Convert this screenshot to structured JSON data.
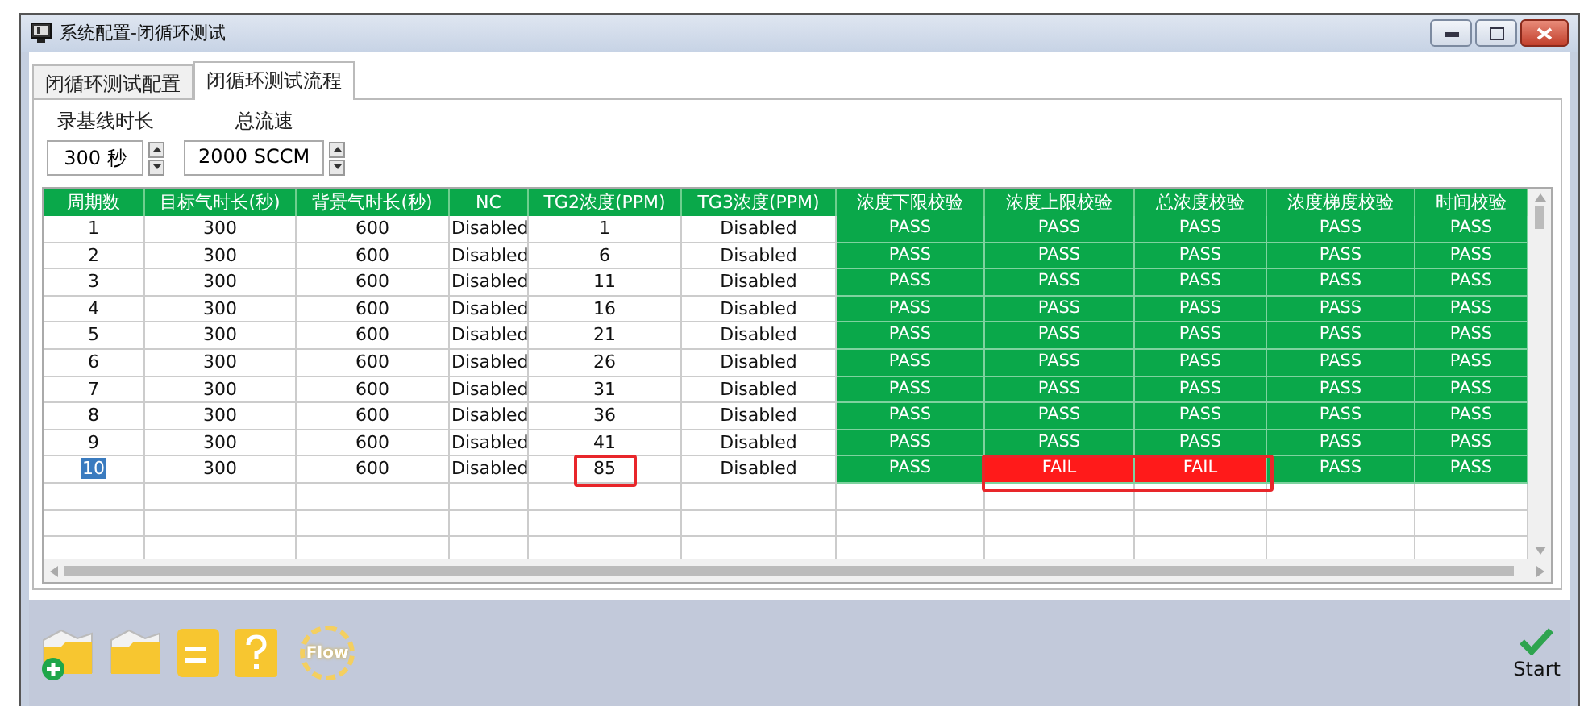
{
  "window": {
    "title": "系统配置-闭循环测试"
  },
  "tabs": [
    {
      "label": "闭循环测试配置",
      "selected": false
    },
    {
      "label": "闭循环测试流程",
      "selected": true
    }
  ],
  "settings": [
    {
      "label": "录基线时长",
      "value": "300 秒"
    },
    {
      "label": "总流速",
      "value": "2000 SCCM"
    }
  ],
  "table": {
    "columns": [
      "周期数",
      "目标气时长(秒)",
      "背景气时长(秒)",
      "NC",
      "TG2浓度(PPM)",
      "TG3浓度(PPM)",
      "浓度下限校验",
      "浓度上限校验",
      "总浓度校验",
      "浓度梯度校验",
      "时间校验"
    ],
    "rows": [
      {
        "cells": [
          "1",
          "300",
          "600",
          "Disabled",
          "1",
          "Disabled"
        ],
        "checks": [
          {
            "text": "PASS",
            "failed": false,
            "outlined": false
          },
          {
            "text": "PASS",
            "failed": false,
            "outlined": false
          },
          {
            "text": "PASS",
            "failed": false,
            "outlined": false
          },
          {
            "text": "PASS",
            "failed": false,
            "outlined": false
          },
          {
            "text": "PASS",
            "failed": false,
            "outlined": false
          }
        ],
        "selected": false,
        "tg2_outlined": false
      },
      {
        "cells": [
          "2",
          "300",
          "600",
          "Disabled",
          "6",
          "Disabled"
        ],
        "checks": [
          {
            "text": "PASS",
            "failed": false,
            "outlined": false
          },
          {
            "text": "PASS",
            "failed": false,
            "outlined": false
          },
          {
            "text": "PASS",
            "failed": false,
            "outlined": false
          },
          {
            "text": "PASS",
            "failed": false,
            "outlined": false
          },
          {
            "text": "PASS",
            "failed": false,
            "outlined": false
          }
        ],
        "selected": false,
        "tg2_outlined": false
      },
      {
        "cells": [
          "3",
          "300",
          "600",
          "Disabled",
          "11",
          "Disabled"
        ],
        "checks": [
          {
            "text": "PASS",
            "failed": false,
            "outlined": false
          },
          {
            "text": "PASS",
            "failed": false,
            "outlined": false
          },
          {
            "text": "PASS",
            "failed": false,
            "outlined": false
          },
          {
            "text": "PASS",
            "failed": false,
            "outlined": false
          },
          {
            "text": "PASS",
            "failed": false,
            "outlined": false
          }
        ],
        "selected": false,
        "tg2_outlined": false
      },
      {
        "cells": [
          "4",
          "300",
          "600",
          "Disabled",
          "16",
          "Disabled"
        ],
        "checks": [
          {
            "text": "PASS",
            "failed": false,
            "outlined": false
          },
          {
            "text": "PASS",
            "failed": false,
            "outlined": false
          },
          {
            "text": "PASS",
            "failed": false,
            "outlined": false
          },
          {
            "text": "PASS",
            "failed": false,
            "outlined": false
          },
          {
            "text": "PASS",
            "failed": false,
            "outlined": false
          }
        ],
        "selected": false,
        "tg2_outlined": false
      },
      {
        "cells": [
          "5",
          "300",
          "600",
          "Disabled",
          "21",
          "Disabled"
        ],
        "checks": [
          {
            "text": "PASS",
            "failed": false,
            "outlined": false
          },
          {
            "text": "PASS",
            "failed": false,
            "outlined": false
          },
          {
            "text": "PASS",
            "failed": false,
            "outlined": false
          },
          {
            "text": "PASS",
            "failed": false,
            "outlined": false
          },
          {
            "text": "PASS",
            "failed": false,
            "outlined": false
          }
        ],
        "selected": false,
        "tg2_outlined": false
      },
      {
        "cells": [
          "6",
          "300",
          "600",
          "Disabled",
          "26",
          "Disabled"
        ],
        "checks": [
          {
            "text": "PASS",
            "failed": false,
            "outlined": false
          },
          {
            "text": "PASS",
            "failed": false,
            "outlined": false
          },
          {
            "text": "PASS",
            "failed": false,
            "outlined": false
          },
          {
            "text": "PASS",
            "failed": false,
            "outlined": false
          },
          {
            "text": "PASS",
            "failed": false,
            "outlined": false
          }
        ],
        "selected": false,
        "tg2_outlined": false
      },
      {
        "cells": [
          "7",
          "300",
          "600",
          "Disabled",
          "31",
          "Disabled"
        ],
        "checks": [
          {
            "text": "PASS",
            "failed": false,
            "outlined": false
          },
          {
            "text": "PASS",
            "failed": false,
            "outlined": false
          },
          {
            "text": "PASS",
            "failed": false,
            "outlined": false
          },
          {
            "text": "PASS",
            "failed": false,
            "outlined": false
          },
          {
            "text": "PASS",
            "failed": false,
            "outlined": false
          }
        ],
        "selected": false,
        "tg2_outlined": false
      },
      {
        "cells": [
          "8",
          "300",
          "600",
          "Disabled",
          "36",
          "Disabled"
        ],
        "checks": [
          {
            "text": "PASS",
            "failed": false,
            "outlined": false
          },
          {
            "text": "PASS",
            "failed": false,
            "outlined": false
          },
          {
            "text": "PASS",
            "failed": false,
            "outlined": false
          },
          {
            "text": "PASS",
            "failed": false,
            "outlined": false
          },
          {
            "text": "PASS",
            "failed": false,
            "outlined": false
          }
        ],
        "selected": false,
        "tg2_outlined": false
      },
      {
        "cells": [
          "9",
          "300",
          "600",
          "Disabled",
          "41",
          "Disabled"
        ],
        "checks": [
          {
            "text": "PASS",
            "failed": false,
            "outlined": false
          },
          {
            "text": "PASS",
            "failed": false,
            "outlined": false
          },
          {
            "text": "PASS",
            "failed": false,
            "outlined": false
          },
          {
            "text": "PASS",
            "failed": false,
            "outlined": false
          },
          {
            "text": "PASS",
            "failed": false,
            "outlined": false
          }
        ],
        "selected": false,
        "tg2_outlined": false
      },
      {
        "cells": [
          "10",
          "300",
          "600",
          "Disabled",
          "85",
          "Disabled"
        ],
        "checks": [
          {
            "text": "PASS",
            "failed": false,
            "outlined": false
          },
          {
            "text": "FAIL",
            "failed": true,
            "outlined": true
          },
          {
            "text": "FAIL",
            "failed": true,
            "outlined": true
          },
          {
            "text": "PASS",
            "failed": false,
            "outlined": false
          },
          {
            "text": "PASS",
            "failed": false,
            "outlined": false
          }
        ],
        "selected": true,
        "tg2_outlined": true
      }
    ]
  },
  "toolbar": {
    "flow_label": "Flow",
    "start_label": "Start"
  }
}
